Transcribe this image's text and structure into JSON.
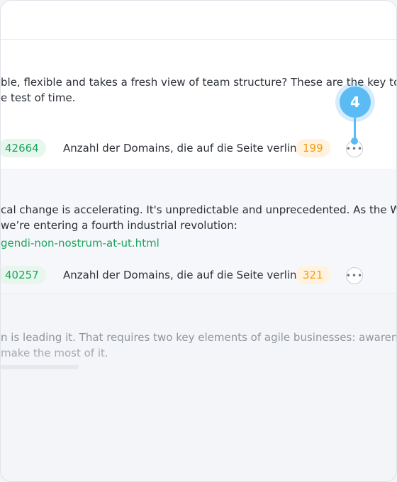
{
  "items": [
    {
      "text_line1": "ble, flexible and takes a fresh view of team structure? These are the key to create",
      "text_line2": "e test of time.",
      "count": "42664",
      "metric_label": "Anzahl der Domains, die auf die Seite verlinken",
      "domains": "199"
    },
    {
      "text_line1": "cal change is accelerating. It's unpredictable and unprecedented. As the World Economic",
      "text_line2": " we’re entering a fourth industrial revolution:",
      "link": "gendi-non-nostrum-at-ut.html",
      "count": "40257",
      "metric_label": "Anzahl der Domains, die auf die Seite verlinken",
      "domains": "321"
    },
    {
      "text_line1": "n is leading it. That requires two key elements of agile businesses: awareness of d",
      "text_line2": "make the most of it."
    }
  ],
  "step_badge": "4",
  "more_glyph": "•••"
}
